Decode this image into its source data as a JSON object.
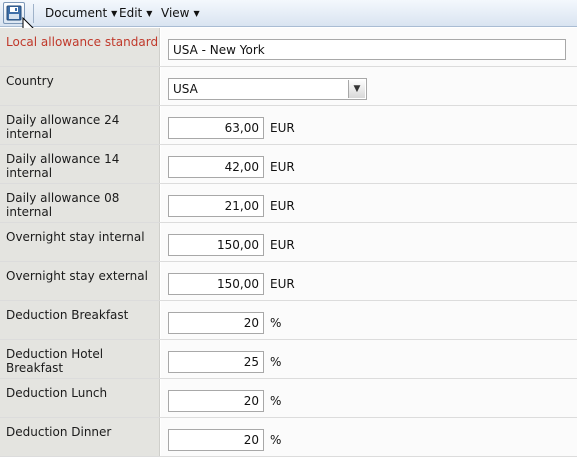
{
  "toolbar": {
    "save_icon": "floppy-disk-icon",
    "menus": [
      {
        "label": "Document"
      },
      {
        "label": "Edit"
      },
      {
        "label": "View"
      }
    ]
  },
  "form": {
    "rows": [
      {
        "label": "Local allowance standard",
        "value": "USA - New York",
        "unit": ""
      },
      {
        "label": "Country",
        "value": "USA",
        "unit": ""
      },
      {
        "label": "Daily allowance 24 internal",
        "value": "63,00",
        "unit": "EUR"
      },
      {
        "label": "Daily allowance 14 internal",
        "value": "42,00",
        "unit": "EUR"
      },
      {
        "label": "Daily allowance 08 internal",
        "value": "21,00",
        "unit": "EUR"
      },
      {
        "label": "Overnight stay internal",
        "value": "150,00",
        "unit": "EUR"
      },
      {
        "label": "Overnight stay external",
        "value": "150,00",
        "unit": "EUR"
      },
      {
        "label": "Deduction Breakfast",
        "value": "20",
        "unit": "%"
      },
      {
        "label": "Deduction Hotel Breakfast",
        "value": "25",
        "unit": "%"
      },
      {
        "label": "Deduction Lunch",
        "value": "20",
        "unit": "%"
      },
      {
        "label": "Deduction Dinner",
        "value": "20",
        "unit": "%"
      }
    ]
  },
  "colors": {
    "required_label": "#c0392b",
    "label_bg": "#e4e4e0",
    "toolbar_bg": "#dde7f3"
  }
}
